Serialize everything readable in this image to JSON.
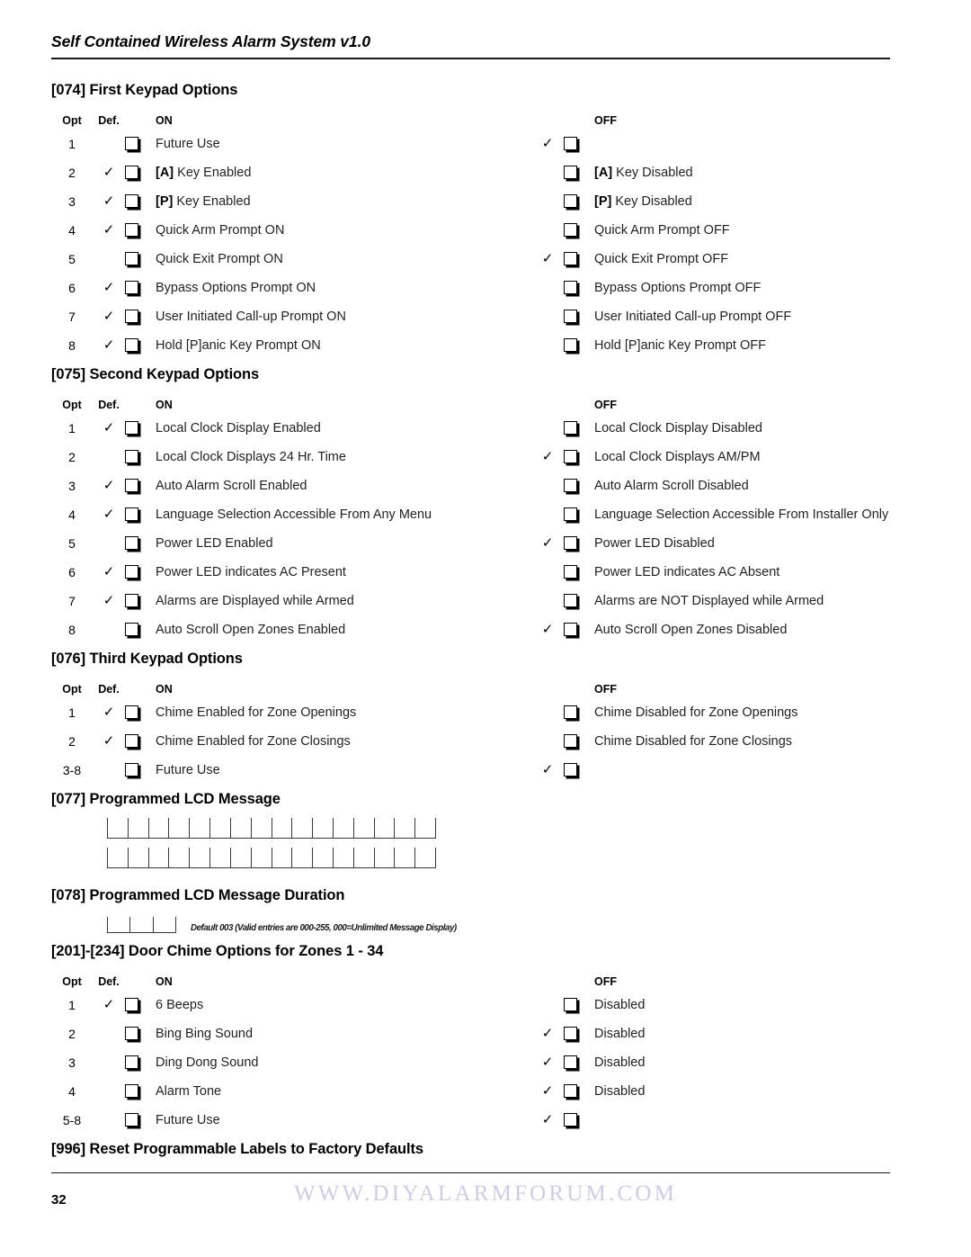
{
  "document": {
    "running_head": "Self Contained Wireless Alarm System v1.0",
    "page_number": "32",
    "watermark": "WWW.DIYALARMFORUM.COM"
  },
  "column_headers": {
    "opt": "Opt",
    "def": "Def.",
    "on": "ON",
    "off": "OFF"
  },
  "sections": [
    {
      "title": "[074] First Keypad Options",
      "rows": [
        {
          "opt": "1",
          "on_def": false,
          "on_label": "Future Use",
          "off_def": true,
          "off_label": ""
        },
        {
          "opt": "2",
          "on_def": true,
          "on_label_bold": "[A]",
          "on_label": " Key Enabled",
          "off_def": false,
          "off_label_bold": "[A]",
          "off_label": " Key Disabled"
        },
        {
          "opt": "3",
          "on_def": true,
          "on_label_bold": "[P]",
          "on_label": " Key Enabled",
          "off_def": false,
          "off_label_bold": "[P]",
          "off_label": " Key Disabled"
        },
        {
          "opt": "4",
          "on_def": true,
          "on_label": "Quick Arm Prompt ON",
          "off_def": false,
          "off_label": "Quick Arm Prompt OFF"
        },
        {
          "opt": "5",
          "on_def": false,
          "on_label": "Quick Exit Prompt ON",
          "off_def": true,
          "off_label": "Quick Exit Prompt OFF"
        },
        {
          "opt": "6",
          "on_def": true,
          "on_label": "Bypass Options Prompt ON",
          "off_def": false,
          "off_label": "Bypass Options Prompt OFF"
        },
        {
          "opt": "7",
          "on_def": true,
          "on_label": "User Initiated Call-up Prompt ON",
          "off_def": false,
          "off_label": "User Initiated Call-up Prompt OFF"
        },
        {
          "opt": "8",
          "on_def": true,
          "on_label": "Hold [P]anic Key Prompt ON",
          "off_def": false,
          "off_label": "Hold [P]anic Key Prompt OFF"
        }
      ]
    },
    {
      "title": "[075] Second Keypad Options",
      "rows": [
        {
          "opt": "1",
          "on_def": true,
          "on_label": "Local Clock Display Enabled",
          "off_def": false,
          "off_label": "Local Clock Display Disabled"
        },
        {
          "opt": "2",
          "on_def": false,
          "on_label": "Local Clock Displays 24 Hr. Time",
          "off_def": true,
          "off_label": "Local Clock Displays AM/PM"
        },
        {
          "opt": "3",
          "on_def": true,
          "on_label": "Auto Alarm Scroll Enabled",
          "off_def": false,
          "off_label": "Auto Alarm Scroll Disabled"
        },
        {
          "opt": "4",
          "on_def": true,
          "on_label": "Language Selection Accessible From Any Menu",
          "off_def": false,
          "off_label": "Language Selection Accessible From Installer Only"
        },
        {
          "opt": "5",
          "on_def": false,
          "on_label": "Power LED Enabled",
          "off_def": true,
          "off_label": "Power LED Disabled"
        },
        {
          "opt": "6",
          "on_def": true,
          "on_label": "Power LED indicates AC Present",
          "off_def": false,
          "off_label": "Power LED indicates AC Absent"
        },
        {
          "opt": "7",
          "on_def": true,
          "on_label": "Alarms are Displayed while Armed",
          "off_def": false,
          "off_label": "Alarms are NOT Displayed while Armed"
        },
        {
          "opt": "8",
          "on_def": false,
          "on_label": "Auto Scroll Open Zones Enabled",
          "off_def": true,
          "off_label": "Auto Scroll Open Zones Disabled"
        }
      ]
    },
    {
      "title": "[076] Third Keypad Options",
      "rows": [
        {
          "opt": "1",
          "on_def": true,
          "on_label": "Chime Enabled for Zone Openings",
          "off_def": false,
          "off_label": "Chime Disabled for Zone Openings"
        },
        {
          "opt": "2",
          "on_def": true,
          "on_label": "Chime Enabled for Zone Closings",
          "off_def": false,
          "off_label": "Chime Disabled for Zone Closings"
        },
        {
          "opt": "3-8",
          "on_def": false,
          "on_label": "Future Use",
          "off_def": true,
          "off_label": ""
        }
      ]
    }
  ],
  "lcd_message": {
    "title": "[077] Programmed LCD Message",
    "grid_rows": 2,
    "grid_cells_per_row": 16
  },
  "lcd_duration": {
    "title": "[078] Programmed LCD Message Duration",
    "grid_cells": 3,
    "note": "Default 003   (Valid entries are 000-255,  000=Unlimited Message Display)"
  },
  "door_chime": {
    "title": "[201]-[234] Door Chime Options for Zones 1 - 34",
    "rows": [
      {
        "opt": "1",
        "on_def": true,
        "on_label": "6 Beeps",
        "off_def": false,
        "off_label": "Disabled"
      },
      {
        "opt": "2",
        "on_def": false,
        "on_label": "Bing Bing Sound",
        "off_def": true,
        "off_label": "Disabled"
      },
      {
        "opt": "3",
        "on_def": false,
        "on_label": "Ding Dong Sound",
        "off_def": true,
        "off_label": "Disabled"
      },
      {
        "opt": "4",
        "on_def": false,
        "on_label": "Alarm Tone",
        "off_def": true,
        "off_label": "Disabled"
      },
      {
        "opt": "5-8",
        "on_def": false,
        "on_label": "Future Use",
        "off_def": true,
        "off_label": ""
      }
    ]
  },
  "reset_section": {
    "title": "[996] Reset Programmable Labels to Factory Defaults"
  }
}
